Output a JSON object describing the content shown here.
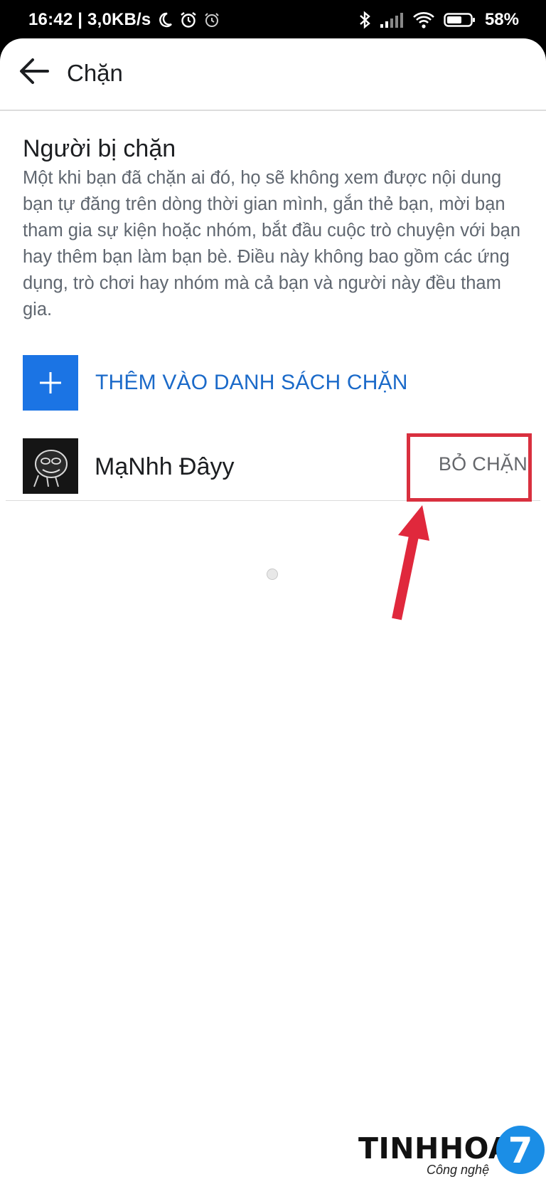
{
  "status_bar": {
    "time_speed": "16:42 | 3,0KB/s",
    "battery": "58%",
    "icons": [
      "moon-icon",
      "alarm-icon",
      "clock-icon",
      "bluetooth-icon",
      "signal-icon",
      "wifi-icon",
      "battery-icon"
    ]
  },
  "app_bar": {
    "title": "Chặn",
    "back_icon": "arrow-left-icon"
  },
  "section": {
    "title": "Người bị chặn",
    "description": "Một khi bạn đã chặn ai đó, họ sẽ không xem được nội dung bạn tự đăng trên dòng thời gian mình, gắn thẻ bạn, mời bạn tham gia sự kiện hoặc nhóm, bắt đầu cuộc trò chuyện với bạn hay thêm bạn làm bạn bè. Điều này không bao gồm các ứng dụng, trò chơi hay nhóm mà cả bạn và người này đều tham gia."
  },
  "add_block": {
    "label": "THÊM VÀO DANH SÁCH CHẶN",
    "icon": "plus-icon"
  },
  "blocked_list": [
    {
      "name": "MạNhh Đâyy",
      "action": "BỎ CHẶN"
    }
  ],
  "annotation": {
    "highlight_color": "#d9303f",
    "arrow_color": "#e0283c"
  },
  "watermark": {
    "brand": "TINHHOA",
    "tagline": "Công nghệ",
    "badge": "7"
  },
  "colors": {
    "accent": "#1b74e4",
    "accent_text": "#1b6ac9",
    "secondary_text": "#606770"
  }
}
